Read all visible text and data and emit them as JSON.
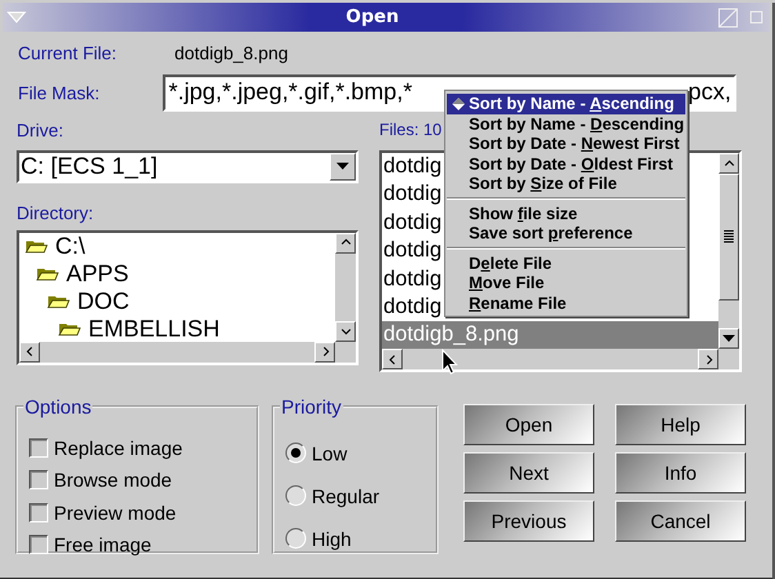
{
  "window": {
    "title": "Open"
  },
  "current_file": {
    "label": "Current File:",
    "value": "dotdigb_8.png"
  },
  "file_mask": {
    "label": "File Mask:",
    "value_visible_start": "*.jpg,*.jpeg,*.gif,*.bmp,*",
    "value_visible_end": "pcx,"
  },
  "drive": {
    "label": "Drive:",
    "value": "C: [ECS 1_1]"
  },
  "directory": {
    "label": "Directory:",
    "tree": [
      {
        "name": "C:\\",
        "children": [
          {
            "name": "APPS",
            "children": [
              {
                "name": "DOC",
                "children": [
                  {
                    "name": "EMBELLISH"
                  }
                ]
              }
            ]
          }
        ]
      }
    ]
  },
  "files": {
    "label": "Files: 10",
    "items": [
      {
        "name": "dotdig",
        "selected": false
      },
      {
        "name": "dotdig",
        "selected": false
      },
      {
        "name": "dotdig",
        "selected": false
      },
      {
        "name": "dotdig",
        "selected": false
      },
      {
        "name": "dotdig",
        "selected": false
      },
      {
        "name": "dotdig",
        "selected": false
      },
      {
        "name": "dotdigb_8.png",
        "selected": true
      }
    ]
  },
  "options": {
    "title": "Options",
    "items": [
      {
        "label": "Replace image",
        "checked": false
      },
      {
        "label": "Browse mode",
        "checked": false
      },
      {
        "label": "Preview mode",
        "checked": false
      },
      {
        "label": "Free image",
        "checked": false
      }
    ]
  },
  "priority": {
    "title": "Priority",
    "items": [
      {
        "label": "Low",
        "selected": true
      },
      {
        "label": "Regular",
        "selected": false
      },
      {
        "label": "High",
        "selected": false
      }
    ]
  },
  "buttons": [
    [
      "Open",
      "Next",
      "Previous"
    ],
    [
      "Help",
      "Info",
      "Cancel"
    ]
  ],
  "context_menu": [
    {
      "kind": "item",
      "before": "Sort by Name - ",
      "key": "A",
      "after": "scending",
      "checked": true,
      "selected": true
    },
    {
      "kind": "item",
      "before": "Sort by Name - ",
      "key": "D",
      "after": "escending",
      "checked": false,
      "selected": false
    },
    {
      "kind": "item",
      "before": "Sort by Date - ",
      "key": "N",
      "after": "ewest First",
      "checked": false,
      "selected": false
    },
    {
      "kind": "item",
      "before": "Sort by Date - ",
      "key": "O",
      "after": "ldest First",
      "checked": false,
      "selected": false
    },
    {
      "kind": "item",
      "before": "Sort by ",
      "key": "S",
      "after": "ize of File",
      "checked": false,
      "selected": false
    },
    {
      "kind": "separator"
    },
    {
      "kind": "item",
      "before": "Show ",
      "key": "f",
      "after": "ile size",
      "checked": false,
      "selected": false
    },
    {
      "kind": "item",
      "before": "Save sort ",
      "key": "p",
      "after": "reference",
      "checked": false,
      "selected": false
    },
    {
      "kind": "separator"
    },
    {
      "kind": "item",
      "before": "D",
      "key": "e",
      "after": "lete File",
      "checked": false,
      "selected": false
    },
    {
      "kind": "item",
      "key": "M",
      "after": "ove File",
      "checked": false,
      "selected": false
    },
    {
      "kind": "item",
      "key": "R",
      "after": "ename File",
      "checked": false,
      "selected": false
    }
  ]
}
